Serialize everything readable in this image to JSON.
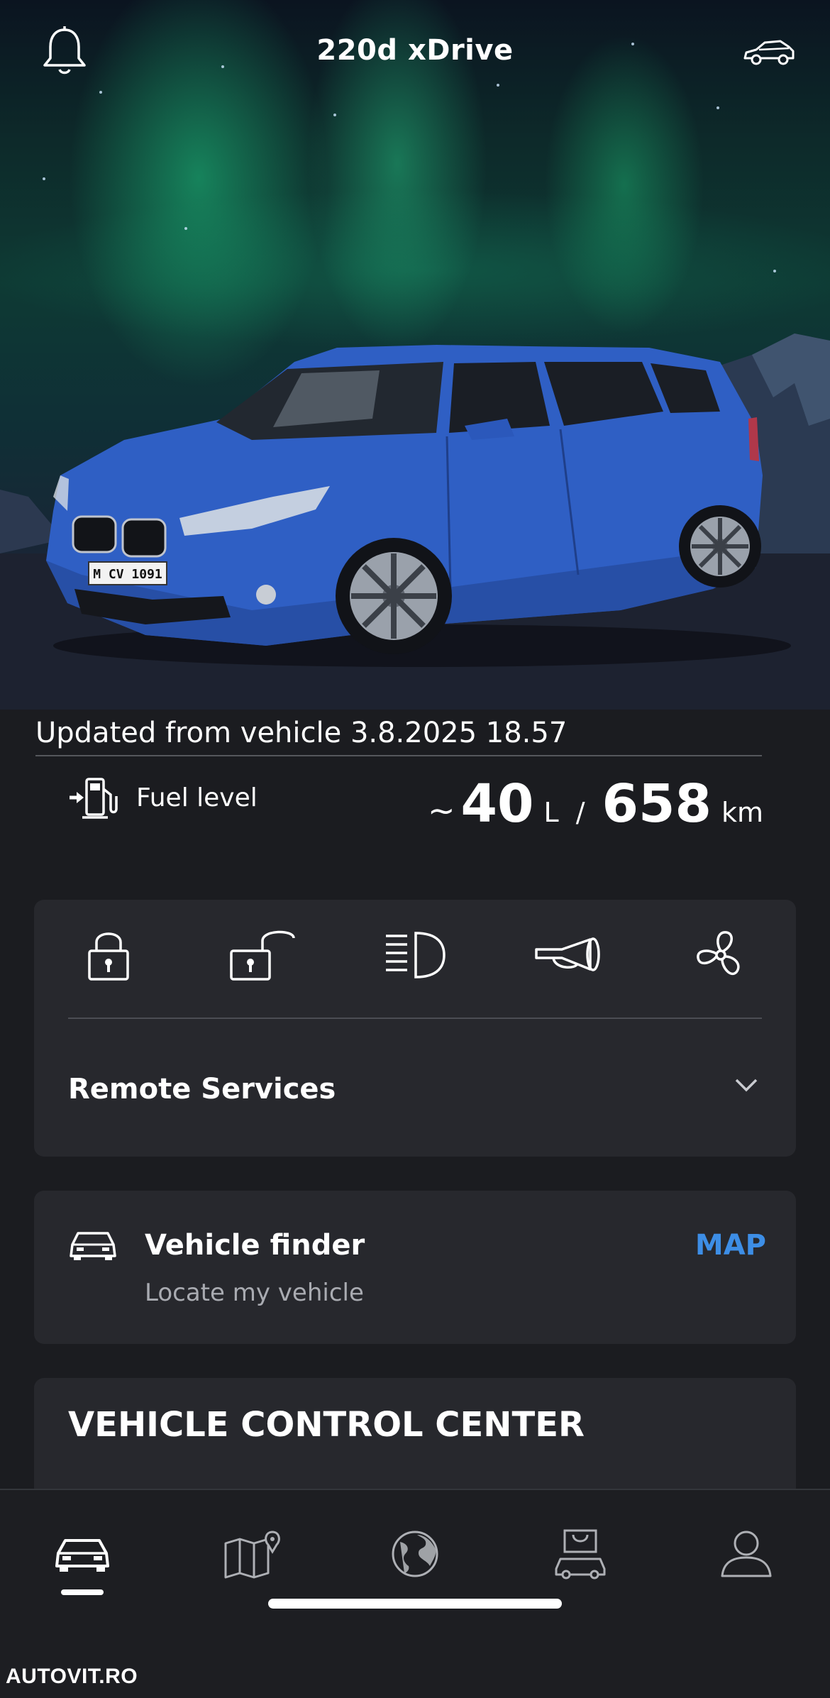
{
  "header": {
    "title": "220d xDrive",
    "icons": {
      "left": "bell-icon",
      "right": "car-outline-icon"
    }
  },
  "vehicle_image": {
    "body_color": "#2f5fc4",
    "plate_text": "M CV 1091"
  },
  "status": {
    "updated_text": "Updated from vehicle 3.8.2025 18.57",
    "fuel_label": "Fuel level",
    "fuel_prefix": "~",
    "fuel_amount": "40",
    "fuel_unit": "L",
    "separator": "/",
    "range_amount": "658",
    "range_unit": "km"
  },
  "remote_services": {
    "title": "Remote Services",
    "icons": [
      "lock-icon",
      "unlock-icon",
      "headlight-icon",
      "horn-icon",
      "fan-icon"
    ]
  },
  "vehicle_finder": {
    "title": "Vehicle finder",
    "subtitle": "Locate my vehicle",
    "action_label": "MAP"
  },
  "control_center": {
    "title": "VEHICLE CONTROL CENTER"
  },
  "bottom_nav": {
    "items": [
      "car-icon",
      "map-pin-icon",
      "globe-icon",
      "shop-icon",
      "profile-icon"
    ],
    "active": "car-icon"
  },
  "watermark": "AUTOVIT.RO",
  "colors": {
    "background": "#1b1c20",
    "card": "#27282d",
    "accent": "#3d8ee6",
    "secondary_text": "#a9abb1"
  }
}
